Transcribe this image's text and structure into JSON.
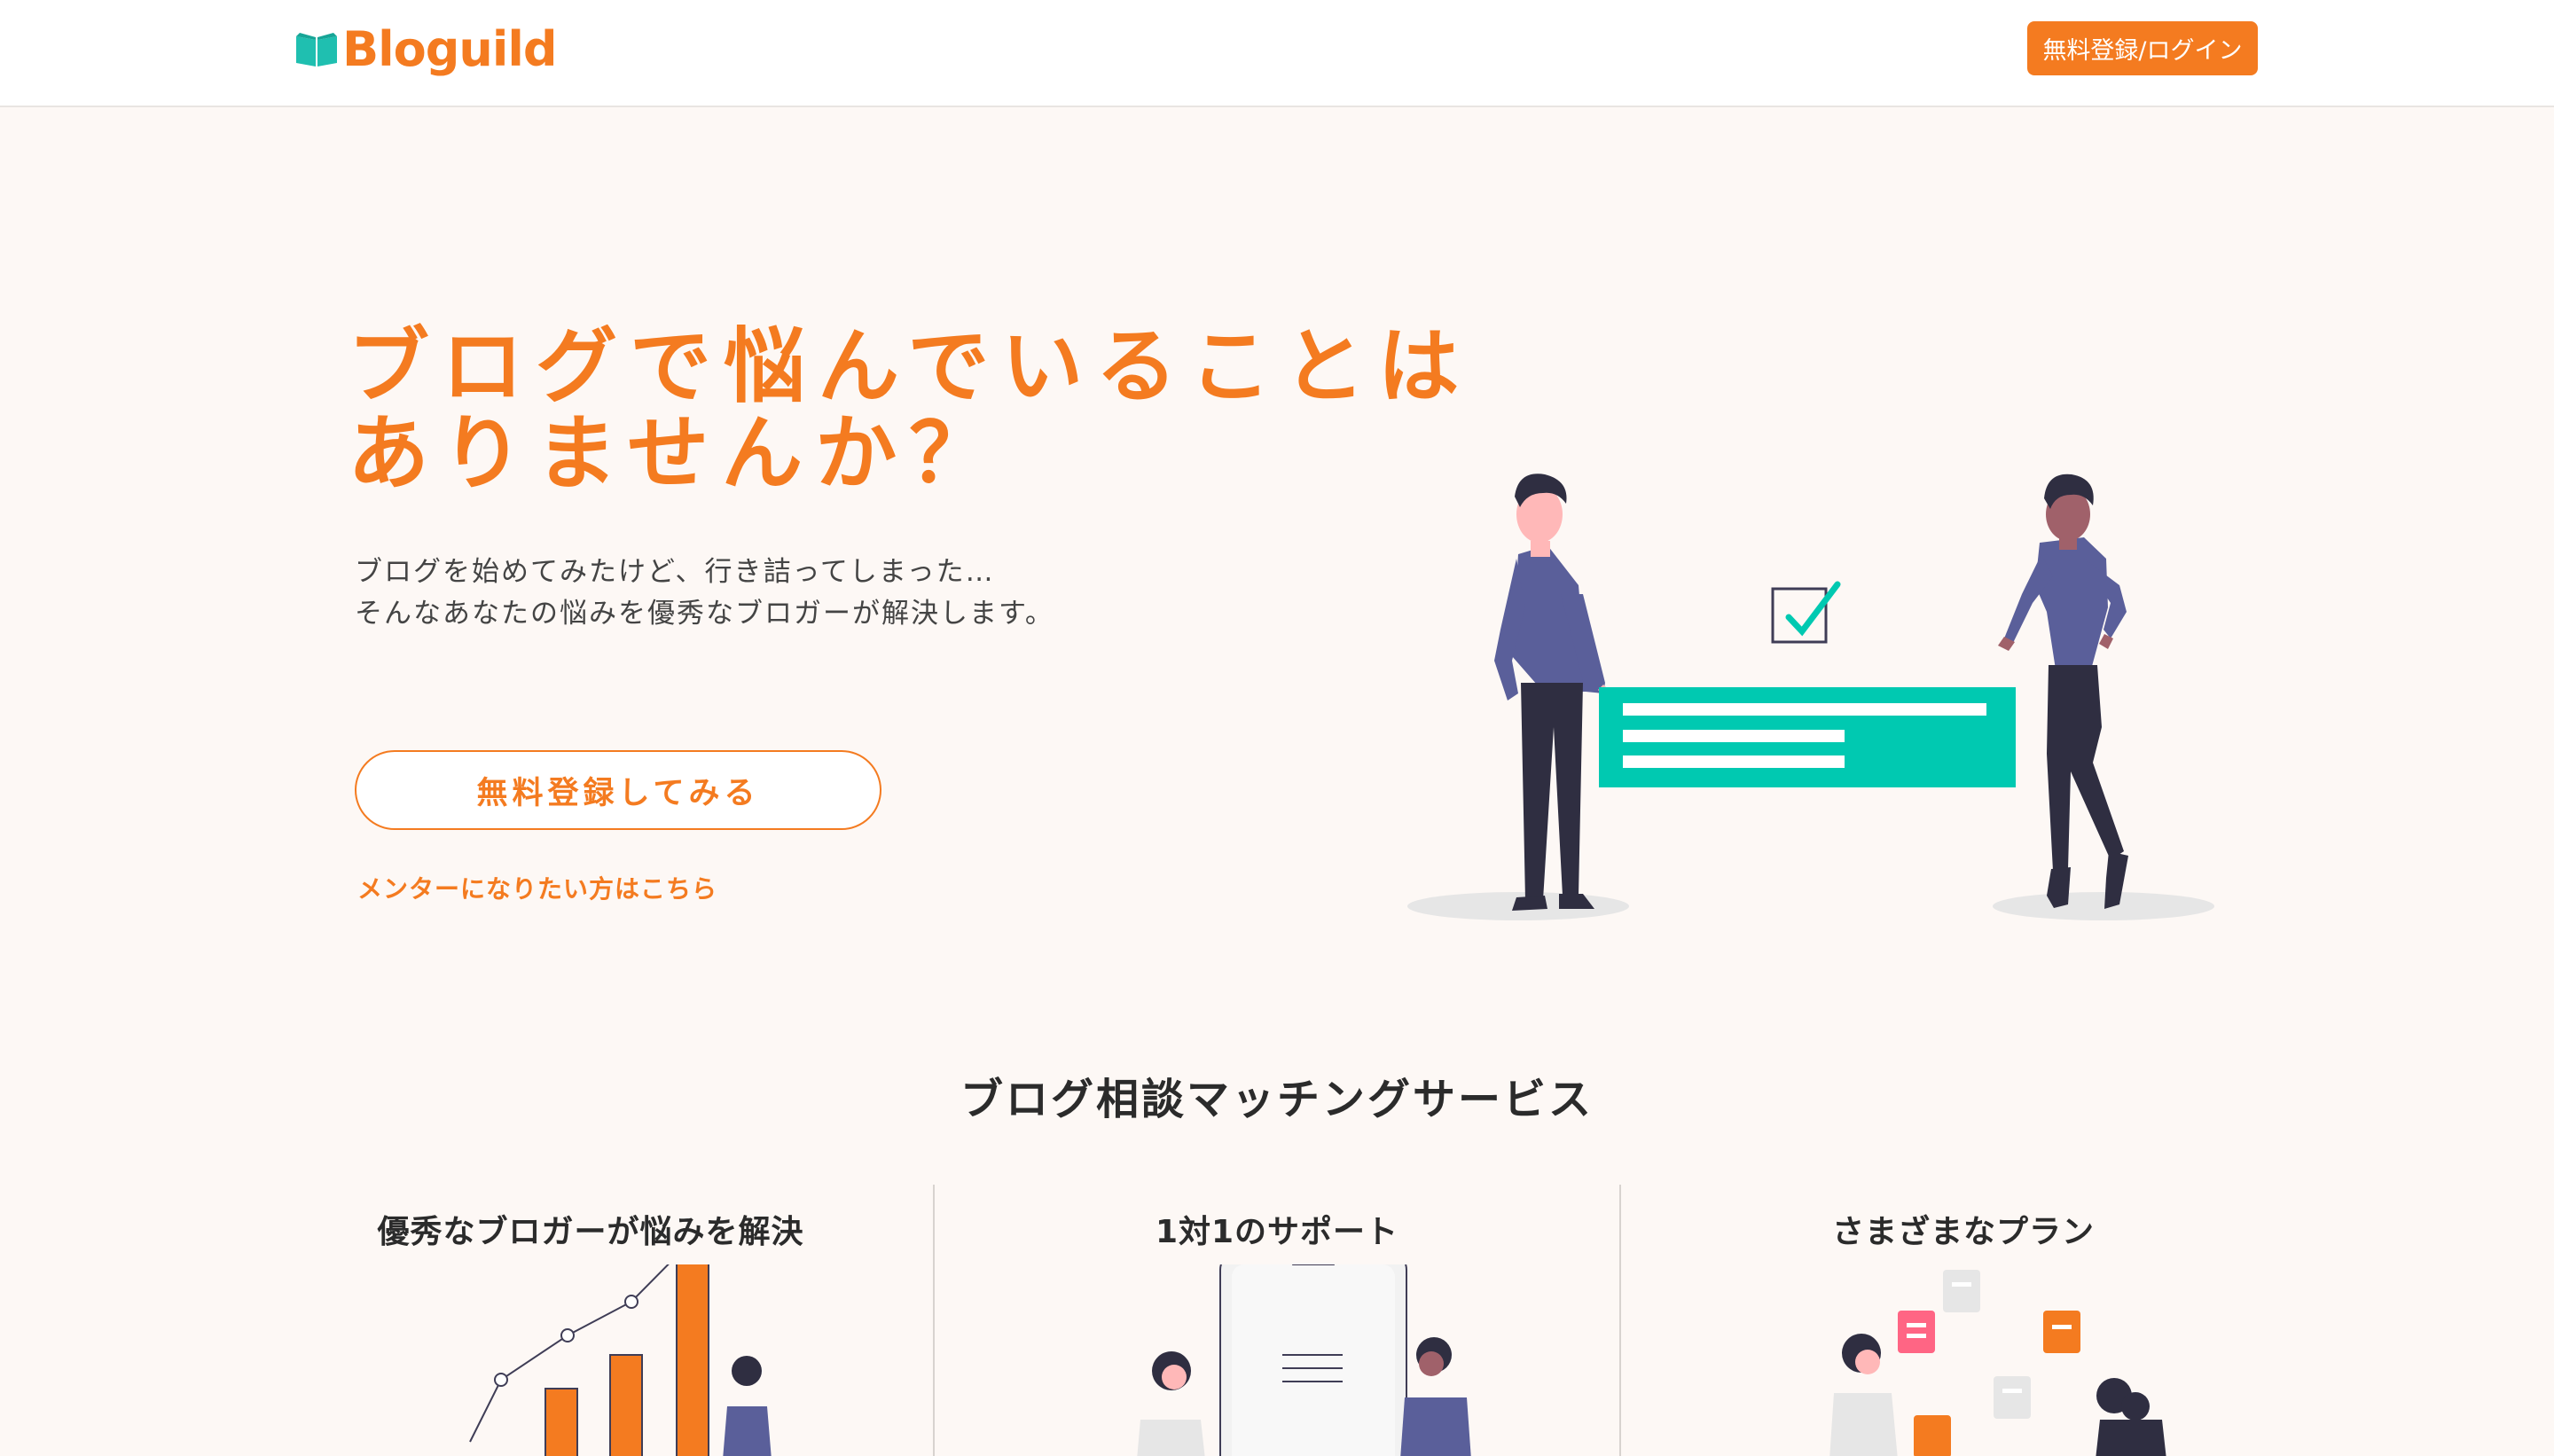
{
  "header": {
    "logo_text": "Bloguild",
    "login_label": "無料登録/ログイン"
  },
  "hero": {
    "title_line1": "ブログで悩んでいることは",
    "title_line2": "ありませんか？",
    "desc_line1": "ブログを始めてみたけど、行き詰ってしまった…",
    "desc_line2": "そんなあなたの悩みを優秀なブロガーが解決します。",
    "cta_label": "無料登録してみる",
    "mentor_link": "メンターになりたい方はこちら"
  },
  "services": {
    "title": "ブログ相談マッチングサービス",
    "features": [
      {
        "title": "優秀なブロガーが悩みを解決"
      },
      {
        "title": "1対1のサポート"
      },
      {
        "title": "さまざまなプラン"
      }
    ]
  },
  "colors": {
    "brand_orange": "#f47b20",
    "accent_teal": "#00c9b1",
    "shirt_purple": "#5a5f9a",
    "pants_dark": "#2f2e41",
    "background": "#fdf8f5"
  },
  "icons": [
    "book-icon",
    "checkbox-icon"
  ]
}
